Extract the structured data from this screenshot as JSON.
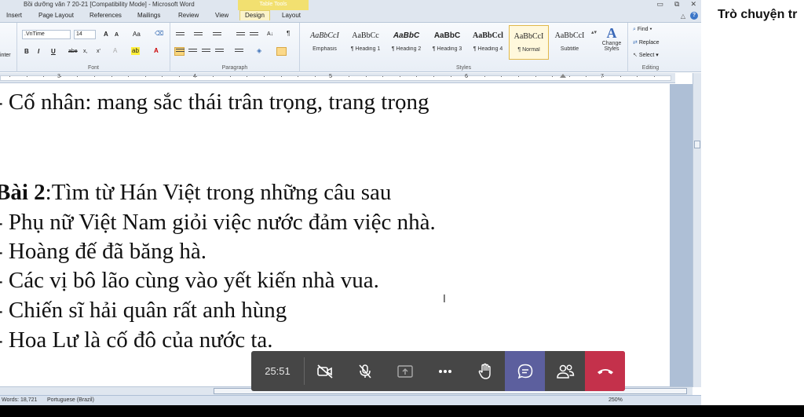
{
  "word": {
    "title": "Bồi dưỡng văn 7 20-21 [Compatibility Mode] - Microsoft Word",
    "context_tab": "Table Tools",
    "tabs": [
      "Insert",
      "Page Layout",
      "References",
      "Mailings",
      "Review",
      "View",
      "Design",
      "Layout"
    ],
    "clipboard_label": "inter",
    "font": {
      "name": ".VnTime",
      "size": "14",
      "label": "Font",
      "grow": "A",
      "shrink": "A",
      "case": "Aa",
      "bold": "B",
      "italic": "I",
      "underline": "U",
      "strike": "abe",
      "subscript": "x,",
      "superscript": "x'"
    },
    "paragraph": {
      "label": "Paragraph",
      "pilcrow": "¶"
    },
    "styles": {
      "label": "Styles",
      "items": [
        {
          "sample": "AaBbCcI",
          "name": "Emphasis"
        },
        {
          "sample": "AaBbCc",
          "name": "¶ Heading 1"
        },
        {
          "sample": "AaBbC",
          "name": "¶ Heading 2"
        },
        {
          "sample": "AaBbC",
          "name": "¶ Heading 3"
        },
        {
          "sample": "AaBbCcl",
          "name": "¶ Heading 4"
        },
        {
          "sample": "AaBbCcI",
          "name": "¶ Normal"
        },
        {
          "sample": "AaBbCcI",
          "name": "Subtitle"
        }
      ],
      "change_styles": "Change Styles",
      "change_icon": "A"
    },
    "editing": {
      "label": "Editing",
      "find": "Find",
      "replace": "Replace",
      "select": "Select"
    },
    "ruler_numbers": [
      "3",
      "4",
      "5",
      "6",
      "7"
    ],
    "document_lines": [
      {
        "text": "- Cố nhân:  mang sắc thái trân trọng, trang trọng"
      },
      {
        "text": ""
      },
      {
        "text": ""
      },
      {
        "bold": "Bài 2",
        "text": ":Tìm từ Hán Việt trong những câu sau"
      },
      {
        "text": "- Phụ nữ Việt Nam giỏi việc nước đảm việc nhà."
      },
      {
        "text": "- Hoàng đế đã băng hà."
      },
      {
        "text": "- Các vị bô lão cùng vào yết kiến nhà vua."
      },
      {
        "text": "- Chiến sĩ hải quân rất anh hùng"
      },
      {
        "text": "- Hoa Lư là cố đô của nước ta."
      }
    ],
    "status": {
      "words": "Words: 18,721",
      "language": "Portuguese (Brazil)",
      "zoom": "250%"
    }
  },
  "chat_panel": {
    "title": "Trò chuyện tr"
  },
  "call_controls": {
    "timer": "25:51",
    "buttons": [
      {
        "name": "camera-off",
        "icon": "video-off-icon"
      },
      {
        "name": "mic-off",
        "icon": "mic-off-icon"
      },
      {
        "name": "share",
        "icon": "share-icon"
      },
      {
        "name": "more",
        "icon": "more-icon"
      },
      {
        "name": "raise-hand",
        "icon": "hand-icon"
      },
      {
        "name": "chat",
        "icon": "chat-icon"
      },
      {
        "name": "participants",
        "icon": "people-icon"
      },
      {
        "name": "hang-up",
        "icon": "phone-hangup-icon"
      }
    ],
    "colors": {
      "bar": "#464646",
      "chat_active": "#5c5f9e",
      "hangup": "#c4314b"
    }
  }
}
